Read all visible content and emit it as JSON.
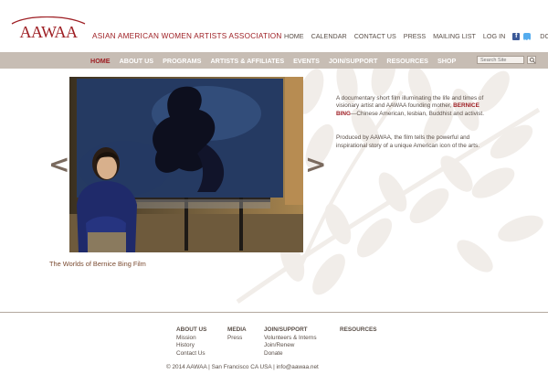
{
  "header": {
    "org_name": "ASIAN AMERICAN WOMEN ARTISTS ASSOCIATION",
    "logo_text": "AAWAA",
    "top_links": [
      "HOME",
      "CALENDAR",
      "CONTACT US",
      "PRESS",
      "MAILING LIST",
      "LOG IN"
    ],
    "donate_label": "DONATE",
    "social_icons": [
      "facebook-icon",
      "twitter-icon"
    ]
  },
  "nav": {
    "items": [
      "HOME",
      "ABOUT US",
      "PROGRAMS",
      "ARTISTS & AFFILIATES",
      "EVENTS",
      "JOIN/SUPPORT",
      "RESOURCES",
      "SHOP"
    ],
    "active": "HOME",
    "search_placeholder": "Search Site"
  },
  "carousel": {
    "prev_label": "<",
    "next_label": ">",
    "caption": "The Worlds of Bernice Bing Film"
  },
  "description": {
    "p1_before": "A documentary short film illuminating the life and times of visionary artist and AAWAA founding mother, ",
    "p1_name": "BERNICE BING",
    "p1_after": "—Chinese American, lesbian, Buddhist and activist.",
    "p2": "Produced by AAWAA, the film tells the powerful and inspirational story of a unique American icon of the arts."
  },
  "footer": {
    "columns": [
      {
        "heading": "ABOUT US",
        "links": [
          "Mission",
          "History",
          "Contact Us"
        ]
      },
      {
        "heading": "MEDIA",
        "links": [
          "Press"
        ]
      },
      {
        "heading": "JOIN/SUPPORT",
        "links": [
          "Volunteers & Interns",
          "Join/Renew",
          "Donate"
        ]
      },
      {
        "heading": "RESOURCES",
        "links": []
      }
    ],
    "copyright": "© 2014 AAWAA | San Francisco CA USA | info@aawaa.net"
  },
  "colors": {
    "brand_red": "#9e1f24",
    "nav_bg": "#c7bdb4",
    "text": "#5a4f48"
  }
}
